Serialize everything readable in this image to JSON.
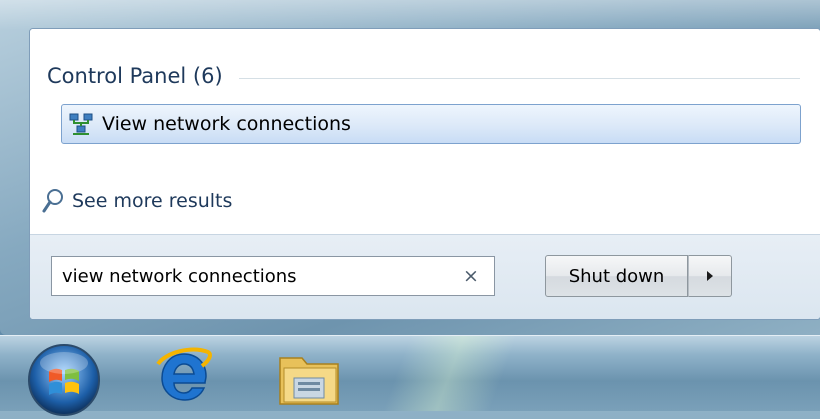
{
  "results": {
    "group_title": "Control Panel (6)",
    "items": [
      {
        "label": "View network connections",
        "icon": "network-connections-icon"
      }
    ],
    "see_more": "See more results"
  },
  "search": {
    "value": "view network connections",
    "clear_glyph": "×"
  },
  "power": {
    "shutdown_label": "Shut down"
  },
  "taskbar": {
    "items": [
      "start-orb",
      "internet-explorer-icon",
      "windows-explorer-icon"
    ]
  },
  "colors": {
    "heading": "#1e395b",
    "highlight": "#dce9f8",
    "highlight_border": "#7da2ce"
  }
}
